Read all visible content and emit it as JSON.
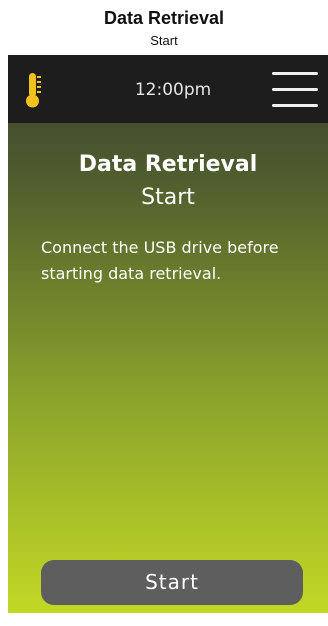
{
  "caption": {
    "title": "Data Retrieval",
    "subtitle": "Start"
  },
  "status_bar": {
    "time": "12:00pm",
    "left_icon": "thermometer-icon",
    "right_icon": "hamburger-menu-icon",
    "thermometer_color": "#f2c21c"
  },
  "screen": {
    "title": "Data Retrieval",
    "subtitle": "Start",
    "message": "Connect the USB drive before starting data retrieval.",
    "start_label": "Start"
  },
  "colors": {
    "status_bar_bg": "#1d1d1d",
    "gradient_top": "#3a3f31",
    "gradient_bottom": "#c2d825",
    "button_bg": "#5e5e5e",
    "text": "#ffffff"
  }
}
